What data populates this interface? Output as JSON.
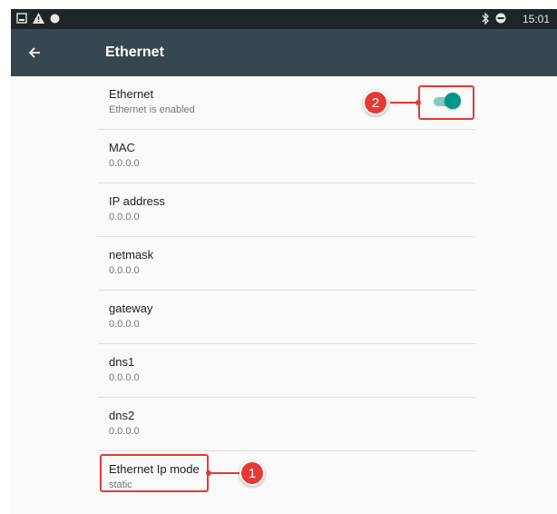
{
  "statusbar": {
    "time": "15:01",
    "icons": [
      "image-icon",
      "warning-icon",
      "circle-icon",
      "bluetooth-icon",
      "do-not-disturb-icon"
    ]
  },
  "appbar": {
    "title": "Ethernet",
    "back_icon": "arrow-back-icon"
  },
  "settings": [
    {
      "title": "Ethernet",
      "subtitle": "Ethernet is enabled",
      "toggle": true
    },
    {
      "title": "MAC",
      "subtitle": "0.0.0.0"
    },
    {
      "title": "IP address",
      "subtitle": "0.0.0.0"
    },
    {
      "title": "netmask",
      "subtitle": "0.0.0.0"
    },
    {
      "title": "gateway",
      "subtitle": "0.0.0.0"
    },
    {
      "title": "dns1",
      "subtitle": "0.0.0.0"
    },
    {
      "title": "dns2",
      "subtitle": "0.0.0.0"
    },
    {
      "title": "Ethernet Ip mode",
      "subtitle": "static"
    }
  ],
  "ethernet_toggle_on": true,
  "annotations": [
    {
      "label": "1",
      "target": "Ethernet Ip mode"
    },
    {
      "label": "2",
      "target": "Ethernet toggle"
    }
  ],
  "colors": {
    "statusbar": "#1f2429",
    "appbar": "#37474f",
    "accent": "#009688",
    "annotation": "#e53935"
  }
}
